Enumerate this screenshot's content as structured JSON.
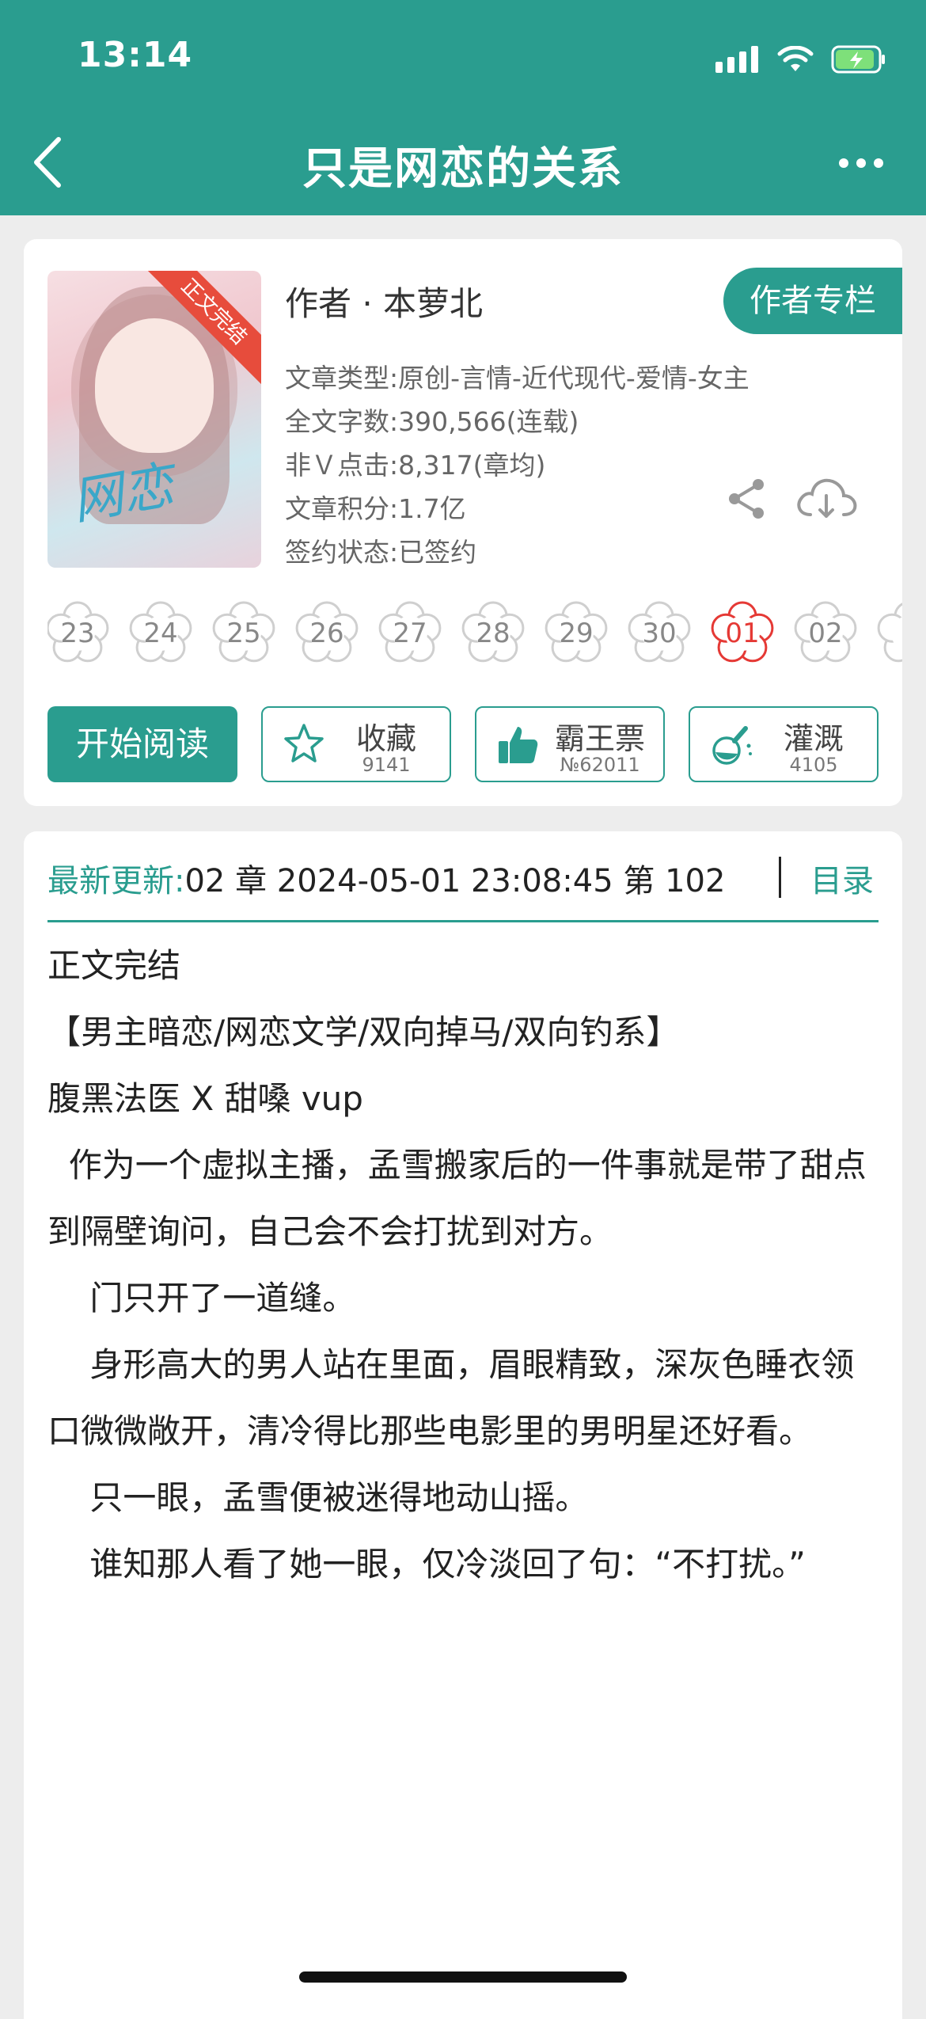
{
  "status": {
    "time": "13:14"
  },
  "nav": {
    "title": "只是网恋的关系"
  },
  "book": {
    "author": "作者 · 本萝北",
    "author_column_label": "作者专栏",
    "meta": [
      "文章类型:原创-言情-近代现代-爱情-女主",
      "全文字数:390,566(连载)",
      "非Ｖ点击:8,317(章均)",
      "文章积分:1.7亿",
      "签约状态:已签约"
    ],
    "cover_band": "正文完结",
    "cover_script": "网恋"
  },
  "flowers": [
    {
      "label": "23",
      "active": false
    },
    {
      "label": "24",
      "active": false
    },
    {
      "label": "25",
      "active": false
    },
    {
      "label": "26",
      "active": false
    },
    {
      "label": "27",
      "active": false
    },
    {
      "label": "28",
      "active": false
    },
    {
      "label": "29",
      "active": false
    },
    {
      "label": "30",
      "active": false
    },
    {
      "label": "01",
      "active": true
    },
    {
      "label": "02",
      "active": false
    }
  ],
  "actions": {
    "read": "开始阅读",
    "collect": {
      "label": "收藏",
      "count": "9141"
    },
    "ticket": {
      "label": "霸王票",
      "count": "№62011"
    },
    "irrigate": {
      "label": "灌溉",
      "count": "4105"
    }
  },
  "update": {
    "label": "最新更新:",
    "value": "02 章 2024-05-01 23:08:45   第 102",
    "toc_label": "目录"
  },
  "content": [
    "正文完结",
    "",
    "【男主暗恋/网恋文学/双向掉马/双向钓系】",
    "腹黑法医 X 甜嗓 vup",
    "",
    "  作为一个虚拟主播，孟雪搬家后的一件事就是带了甜点到隔壁询问，自己会不会打扰到对方。",
    "    门只开了一道缝。",
    "    身形高大的男人站在里面，眉眼精致，深灰色睡衣领口微微敞开，清冷得比那些电影里的男明星还好看。",
    "",
    "    只一眼，孟雪便被迷得地动山摇。",
    "",
    "    谁知那人看了她一眼，仅冷淡回了句：“不打扰。”"
  ],
  "colors": {
    "accent": "#2a9d8f",
    "active_flower": "#e53935"
  }
}
